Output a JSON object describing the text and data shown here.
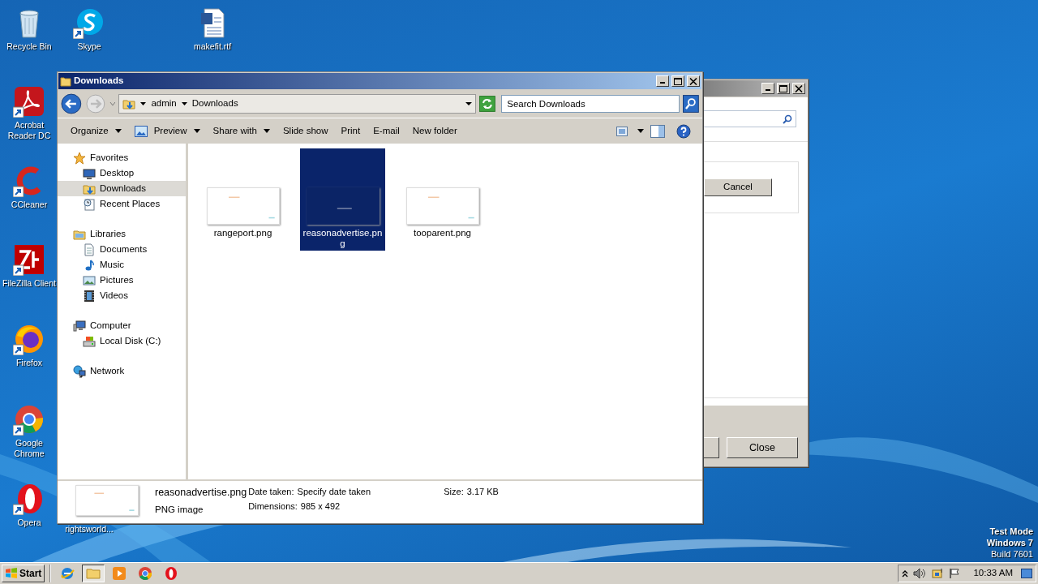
{
  "desktop_icons": [
    {
      "label": "Recycle Bin",
      "kind": "recycle-bin",
      "shortcut": false
    },
    {
      "label": "Skype",
      "kind": "skype",
      "shortcut": true
    },
    {
      "label": "makefit.rtf",
      "kind": "document",
      "shortcut": false
    },
    {
      "label": "Acrobat Reader DC",
      "kind": "acrobat",
      "shortcut": true
    },
    {
      "label": "CCleaner",
      "kind": "ccleaner",
      "shortcut": true
    },
    {
      "label": "FileZilla Client",
      "kind": "filezilla",
      "shortcut": true
    },
    {
      "label": "Firefox",
      "kind": "firefox",
      "shortcut": true
    },
    {
      "label": "Google Chrome",
      "kind": "chrome",
      "shortcut": true
    },
    {
      "label": "Opera",
      "kind": "opera",
      "shortcut": true
    },
    {
      "label": "rightsworld...",
      "kind": "hidden"
    }
  ],
  "back_window": {
    "buttons": [
      "Cancel",
      "Close"
    ]
  },
  "explorer": {
    "title": "Downloads",
    "breadcrumb": [
      "admin",
      "Downloads"
    ],
    "search": {
      "placeholder": "Search Downloads"
    },
    "toolbar": [
      {
        "label": "Organize",
        "dropdown": true,
        "icon": false
      },
      {
        "label": "Preview",
        "dropdown": true,
        "icon": true
      },
      {
        "label": "Share with",
        "dropdown": true,
        "icon": false
      },
      {
        "label": "Slide show",
        "dropdown": false,
        "icon": false
      },
      {
        "label": "Print",
        "dropdown": false,
        "icon": false
      },
      {
        "label": "E-mail",
        "dropdown": false,
        "icon": false
      },
      {
        "label": "New folder",
        "dropdown": false,
        "icon": false
      }
    ],
    "nav": [
      {
        "label": "Favorites",
        "kind": "favorites",
        "selected": false,
        "children": [
          {
            "label": "Desktop",
            "kind": "desktop",
            "selected": false
          },
          {
            "label": "Downloads",
            "kind": "downloads",
            "selected": true
          },
          {
            "label": "Recent Places",
            "kind": "recent",
            "selected": false
          }
        ]
      },
      {
        "label": "Libraries",
        "kind": "libraries",
        "selected": false,
        "children": [
          {
            "label": "Documents",
            "kind": "documents",
            "selected": false
          },
          {
            "label": "Music",
            "kind": "music",
            "selected": false
          },
          {
            "label": "Pictures",
            "kind": "pictures",
            "selected": false
          },
          {
            "label": "Videos",
            "kind": "videos",
            "selected": false
          }
        ]
      },
      {
        "label": "Computer",
        "kind": "computer",
        "selected": false,
        "children": [
          {
            "label": "Local Disk (C:)",
            "kind": "disk",
            "selected": false
          }
        ]
      },
      {
        "label": "Network",
        "kind": "network",
        "selected": false
      }
    ],
    "files": [
      {
        "name": "rangeport.png",
        "kind": "light",
        "selected": false
      },
      {
        "name": "reasonadvertise.png",
        "kind": "dark",
        "selected": true
      },
      {
        "name": "tooparent.png",
        "kind": "light",
        "selected": false
      }
    ],
    "details": {
      "name": "reasonadvertise.png",
      "type": "PNG image",
      "fields": [
        {
          "label": "Date taken:",
          "value": "Specify date taken"
        },
        {
          "label": "Dimensions:",
          "value": "985 x 492"
        },
        {
          "label": "Size:",
          "value": "3.17 KB"
        }
      ]
    }
  },
  "os_notice": [
    "Test Mode",
    "Windows 7",
    "Build 7601"
  ],
  "taskbar": {
    "start": "Start",
    "apps": [
      {
        "kind": "ie",
        "active": false
      },
      {
        "kind": "explorer",
        "active": true
      },
      {
        "kind": "media",
        "active": false
      },
      {
        "kind": "chrome",
        "active": false
      },
      {
        "kind": "opera",
        "active": false
      }
    ],
    "clock": "10:33 AM"
  }
}
